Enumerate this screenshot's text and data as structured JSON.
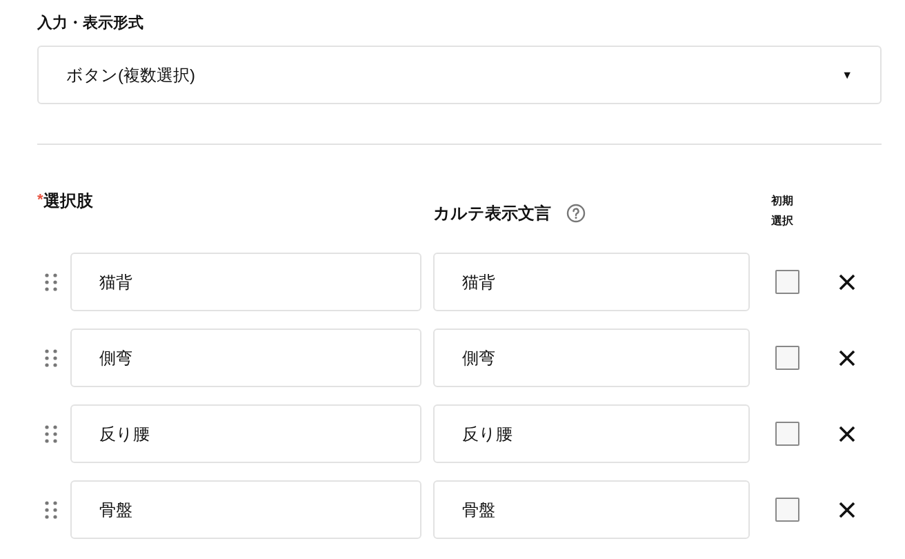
{
  "format_field": {
    "label": "入力・表示形式",
    "value": "ボタン(複数選択)",
    "arrow": "▼"
  },
  "options_header": {
    "required_mark": "*",
    "choices_label": "選択肢",
    "display_text_label": "カルテ表示文言",
    "default_label_lines": [
      "初期",
      "選択"
    ]
  },
  "options": [
    {
      "choice": "猫背",
      "display_text": "猫背",
      "checked": false
    },
    {
      "choice": "側弯",
      "display_text": "側弯",
      "checked": false
    },
    {
      "choice": "反り腰",
      "display_text": "反り腰",
      "checked": false
    },
    {
      "choice": "骨盤",
      "display_text": "骨盤",
      "checked": false
    }
  ]
}
